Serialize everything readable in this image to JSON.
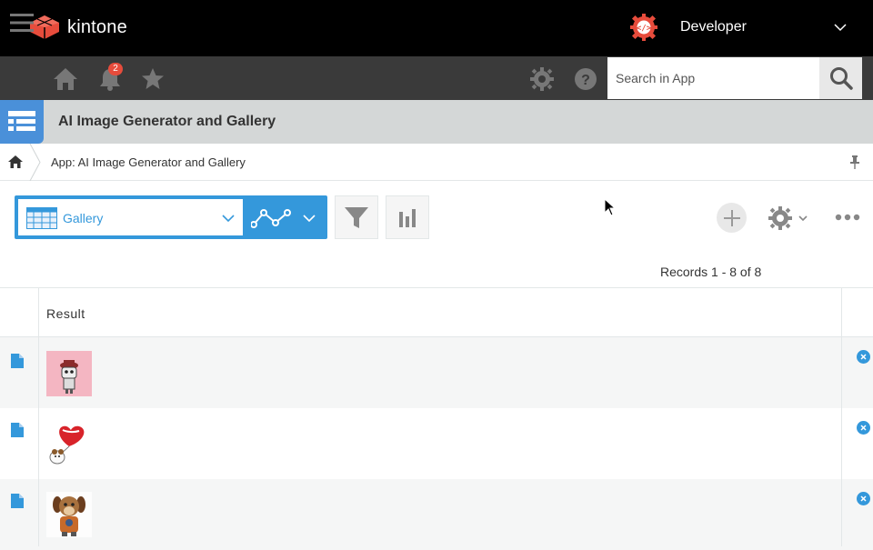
{
  "app": {
    "brand": "kintone",
    "title": "AI Image Generator and Gallery"
  },
  "user": {
    "name": "Developer"
  },
  "notifications": {
    "count": "2"
  },
  "search": {
    "placeholder": "Search in App"
  },
  "breadcrumb": {
    "text": "App: AI Image Generator and Gallery"
  },
  "view": {
    "selected": "Gallery"
  },
  "records": {
    "summary": "Records 1 - 8 of 8"
  },
  "table": {
    "column_header": "Result",
    "rows": [
      {
        "image": "image-robot-dog-icon"
      },
      {
        "image": "image-dog-heart-balloon-icon"
      },
      {
        "image": "image-dog-astronaut-icon"
      }
    ]
  },
  "colors": {
    "accent": "#3498db",
    "topbar": "#000000",
    "toolbar": "#3a3a3a",
    "brand_red": "#e74c3c"
  }
}
